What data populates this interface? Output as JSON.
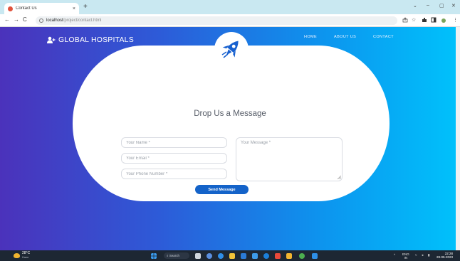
{
  "browser": {
    "tab_title": "Contact Us",
    "tab_close": "×",
    "new_tab": "+",
    "window_controls": [
      "⌄",
      "–",
      "▢",
      "✕"
    ],
    "nav_back": "←",
    "nav_forward": "→",
    "nav_reload": "C",
    "url_host": "localhost",
    "url_path": "/project/contact.html",
    "toolbar_icons": [
      "share-icon",
      "star-icon",
      "extensions-icon",
      "sidebar-icon",
      "profile-icon",
      "menu-icon"
    ]
  },
  "site": {
    "brand": "GLOBAL HOSPITALS",
    "nav": [
      "HOME",
      "ABOUT US",
      "CONTACT"
    ]
  },
  "form": {
    "heading": "Drop Us a Message",
    "name_placeholder": "Your Name *",
    "email_placeholder": "Your Email *",
    "phone_placeholder": "Your Phone Number *",
    "message_placeholder": "Your Message *",
    "submit_label": "Send Message"
  },
  "taskbar": {
    "weather_temp": "28°C",
    "weather_cond": "Haze",
    "search_label": "Search",
    "lang_top": "ENG",
    "lang_bottom": "IN",
    "time": "22:28",
    "date": "28-05-2023"
  },
  "colors": {
    "gradient_start": "#4b32bb",
    "gradient_end": "#00c1fb",
    "button": "#1463c9"
  }
}
